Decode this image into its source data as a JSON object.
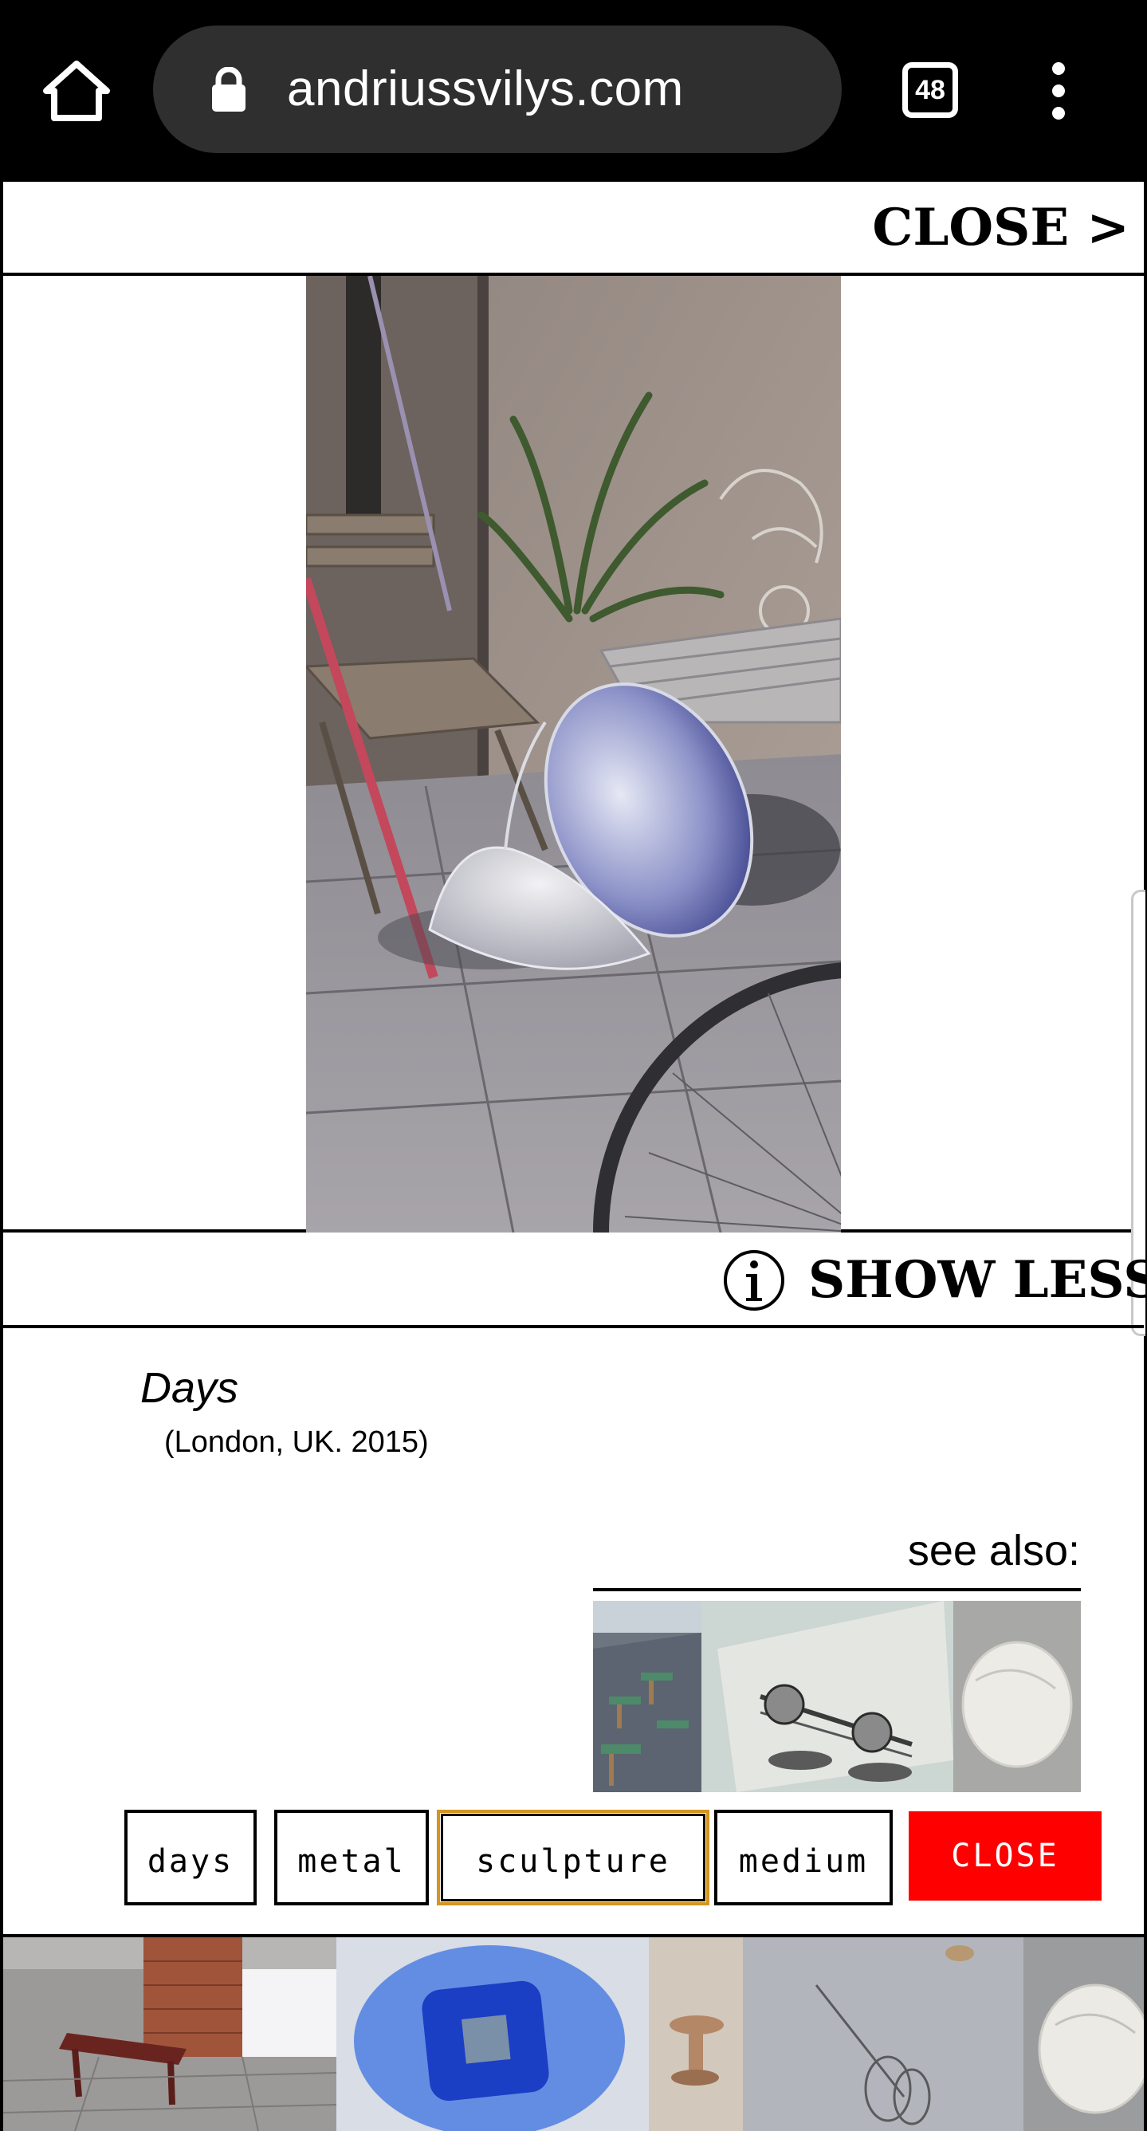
{
  "browser": {
    "url": "andriussvilys.com",
    "tab_count": "48",
    "icons": [
      "home-icon",
      "lock-icon",
      "tabs-icon",
      "more-vert-icon"
    ]
  },
  "topbar": {
    "close_label": "CLOSE >"
  },
  "infobar": {
    "show_less_label": "SHOW LESS",
    "icon": "info-icon"
  },
  "artwork": {
    "title": "Days",
    "location_year": "(London, UK. 2015)"
  },
  "see_also": {
    "heading": "see also:",
    "thumbnails": [
      "cafe-terrace-thumbnail",
      "sculpture-sketch-thumbnail",
      "plaster-shell-thumbnail"
    ]
  },
  "tags": [
    "days",
    "metal",
    "sculpture",
    "medium"
  ],
  "selected_tag": "sculpture",
  "tag_close_label": "CLOSE",
  "filmstrip": [
    "bench-photo",
    "blue-sculpture-photo",
    "clay-object-photo",
    "wire-drawing-photo",
    "shell-photo"
  ],
  "colors": {
    "chrome": "#000000",
    "urlbar": "#2f2f2f",
    "close_button": "#ff0000",
    "selected_tag_border": "#d49521"
  }
}
